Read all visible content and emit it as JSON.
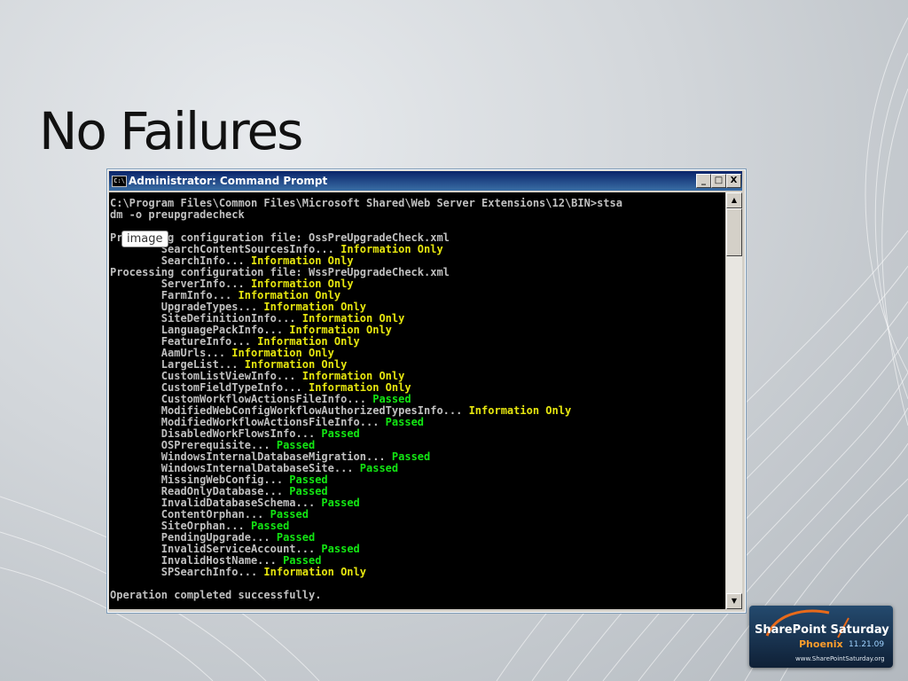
{
  "slide": {
    "title": "No Failures"
  },
  "window": {
    "title": "Administrator: Command Prompt",
    "icon_text": "C:\\",
    "buttons": {
      "minimize": "_",
      "maximize": "□",
      "close": "X"
    }
  },
  "console": {
    "lines": [
      [
        {
          "t": "C:\\Program Files\\Common Files\\Microsoft Shared\\Web Server Extensions\\12\\BIN>stsa"
        }
      ],
      [
        {
          "t": "dm -o preupgradecheck"
        }
      ],
      [
        {
          "t": ""
        }
      ],
      [
        {
          "t": "Processing configuration file: OssPreUpgradeCheck.xml"
        }
      ],
      [
        {
          "t": "        SearchContentSourcesInfo... "
        },
        {
          "t": "Information Only",
          "c": "y"
        }
      ],
      [
        {
          "t": "        SearchInfo... "
        },
        {
          "t": "Information Only",
          "c": "y"
        }
      ],
      [
        {
          "t": "Processing configuration file: WssPreUpgradeCheck.xml"
        }
      ],
      [
        {
          "t": "        ServerInfo... "
        },
        {
          "t": "Information Only",
          "c": "y"
        }
      ],
      [
        {
          "t": "        FarmInfo... "
        },
        {
          "t": "Information Only",
          "c": "y"
        }
      ],
      [
        {
          "t": "        UpgradeTypes... "
        },
        {
          "t": "Information Only",
          "c": "y"
        }
      ],
      [
        {
          "t": "        SiteDefinitionInfo... "
        },
        {
          "t": "Information Only",
          "c": "y"
        }
      ],
      [
        {
          "t": "        LanguagePackInfo... "
        },
        {
          "t": "Information Only",
          "c": "y"
        }
      ],
      [
        {
          "t": "        FeatureInfo... "
        },
        {
          "t": "Information Only",
          "c": "y"
        }
      ],
      [
        {
          "t": "        AamUrls... "
        },
        {
          "t": "Information Only",
          "c": "y"
        }
      ],
      [
        {
          "t": "        LargeList... "
        },
        {
          "t": "Information Only",
          "c": "y"
        }
      ],
      [
        {
          "t": "        CustomListViewInfo... "
        },
        {
          "t": "Information Only",
          "c": "y"
        }
      ],
      [
        {
          "t": "        CustomFieldTypeInfo... "
        },
        {
          "t": "Information Only",
          "c": "y"
        }
      ],
      [
        {
          "t": "        CustomWorkflowActionsFileInfo... "
        },
        {
          "t": "Passed",
          "c": "g"
        }
      ],
      [
        {
          "t": "        ModifiedWebConfigWorkflowAuthorizedTypesInfo... "
        },
        {
          "t": "Information Only",
          "c": "y"
        }
      ],
      [
        {
          "t": "        ModifiedWorkflowActionsFileInfo... "
        },
        {
          "t": "Passed",
          "c": "g"
        }
      ],
      [
        {
          "t": "        DisabledWorkFlowsInfo... "
        },
        {
          "t": "Passed",
          "c": "g"
        }
      ],
      [
        {
          "t": "        OSPrerequisite... "
        },
        {
          "t": "Passed",
          "c": "g"
        }
      ],
      [
        {
          "t": "        WindowsInternalDatabaseMigration... "
        },
        {
          "t": "Passed",
          "c": "g"
        }
      ],
      [
        {
          "t": "        WindowsInternalDatabaseSite... "
        },
        {
          "t": "Passed",
          "c": "g"
        }
      ],
      [
        {
          "t": "        MissingWebConfig... "
        },
        {
          "t": "Passed",
          "c": "g"
        }
      ],
      [
        {
          "t": "        ReadOnlyDatabase... "
        },
        {
          "t": "Passed",
          "c": "g"
        }
      ],
      [
        {
          "t": "        InvalidDatabaseSchema... "
        },
        {
          "t": "Passed",
          "c": "g"
        }
      ],
      [
        {
          "t": "        ContentOrphan... "
        },
        {
          "t": "Passed",
          "c": "g"
        }
      ],
      [
        {
          "t": "        SiteOrphan... "
        },
        {
          "t": "Passed",
          "c": "g"
        }
      ],
      [
        {
          "t": "        PendingUpgrade... "
        },
        {
          "t": "Passed",
          "c": "g"
        }
      ],
      [
        {
          "t": "        InvalidServiceAccount... "
        },
        {
          "t": "Passed",
          "c": "g"
        }
      ],
      [
        {
          "t": "        InvalidHostName... "
        },
        {
          "t": "Passed",
          "c": "g"
        }
      ],
      [
        {
          "t": "        SPSearchInfo... "
        },
        {
          "t": "Information Only",
          "c": "y"
        }
      ],
      [
        {
          "t": ""
        }
      ],
      [
        {
          "t": "Operation completed successfully."
        }
      ]
    ]
  },
  "tooltip": {
    "text": "image"
  },
  "scrollbar": {
    "up": "▲",
    "down": "▼"
  },
  "logo": {
    "line1": "SharePoint Saturday",
    "line2": "Phoenix",
    "date": "11.21.09",
    "url": "www.SharePointSaturday.org"
  },
  "colors": {
    "passed": "#13e613",
    "information_only": "#e6e60f",
    "console_text": "#c0c0c0"
  }
}
